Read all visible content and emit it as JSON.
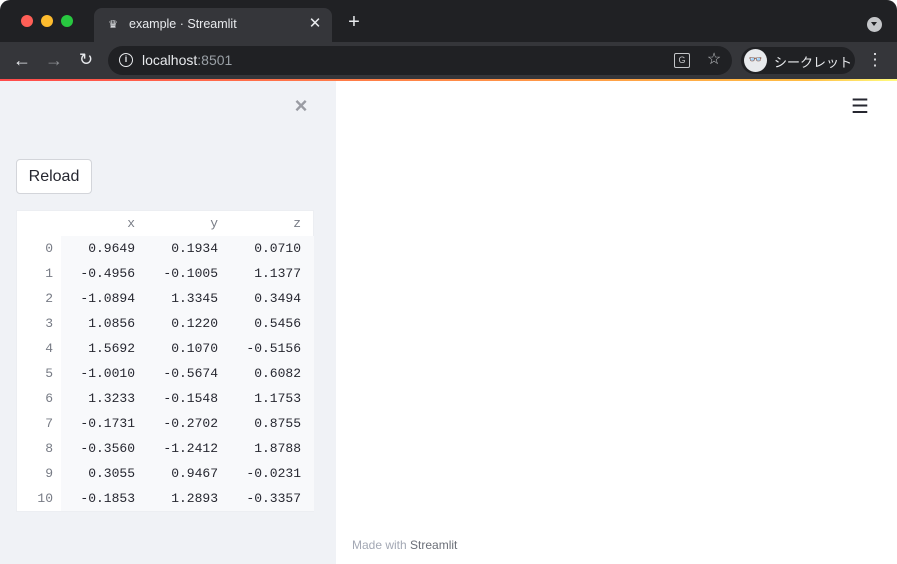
{
  "browser": {
    "tab": {
      "favicon": "♛",
      "title": "example · Streamlit",
      "close_glyph": "✕"
    },
    "new_tab_glyph": "+",
    "toolbar": {
      "back_glyph": "←",
      "forward_glyph": "→",
      "reload_glyph": "↻",
      "info_glyph": "i",
      "url_host": "localhost",
      "url_port": ":8501",
      "translate_glyph": "G",
      "star_glyph": "☆",
      "incognito_glyph": "👓",
      "incognito_label": "シークレット",
      "menu_glyph": "⋮"
    },
    "colors": {
      "tab_strip": "#202124",
      "toolbar": "#35363a",
      "accent_red": "#ff4b4b"
    }
  },
  "sidebar": {
    "close_glyph": "×",
    "reload_label": "Reload"
  },
  "dataframe": {
    "columns": [
      "x",
      "y",
      "z"
    ],
    "rows": [
      {
        "index": "0",
        "x": "0.9649",
        "y": "0.1934",
        "z": "0.0710"
      },
      {
        "index": "1",
        "x": "-0.4956",
        "y": "-0.1005",
        "z": "1.1377"
      },
      {
        "index": "2",
        "x": "-1.0894",
        "y": "1.3345",
        "z": "0.3494"
      },
      {
        "index": "3",
        "x": "1.0856",
        "y": "0.1220",
        "z": "0.5456"
      },
      {
        "index": "4",
        "x": "1.5692",
        "y": "0.1070",
        "z": "-0.5156"
      },
      {
        "index": "5",
        "x": "-1.0010",
        "y": "-0.5674",
        "z": "0.6082"
      },
      {
        "index": "6",
        "x": "1.3233",
        "y": "-0.1548",
        "z": "1.1753"
      },
      {
        "index": "7",
        "x": "-0.1731",
        "y": "-0.2702",
        "z": "0.8755"
      },
      {
        "index": "8",
        "x": "-0.3560",
        "y": "-1.2412",
        "z": "1.8788"
      },
      {
        "index": "9",
        "x": "0.3055",
        "y": "0.9467",
        "z": "-0.0231"
      },
      {
        "index": "10",
        "x": "-0.1853",
        "y": "1.2893",
        "z": "-0.3357"
      }
    ]
  },
  "main": {
    "menu_glyph": "☰",
    "footer_prefix": "Made with ",
    "footer_link": "Streamlit"
  }
}
